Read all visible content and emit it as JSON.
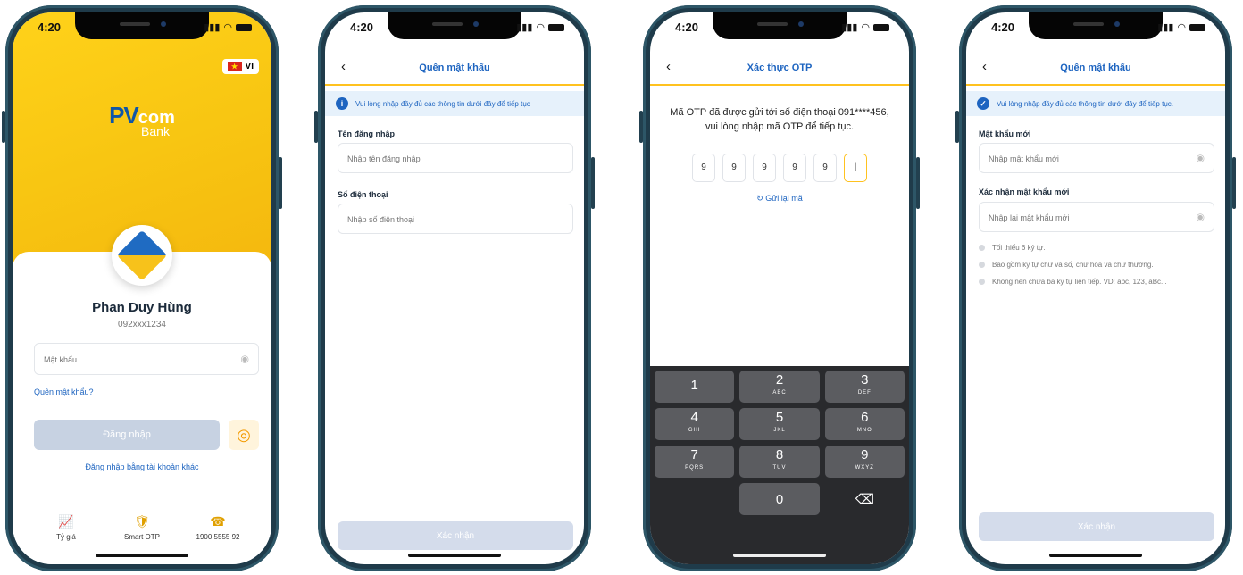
{
  "status": {
    "time": "4:20"
  },
  "screen1": {
    "lang": "VI",
    "flag_star": "★",
    "brand": {
      "pv": "PV",
      "com": "com",
      "bank": "Bank"
    },
    "user_name": "Phan Duy Hùng",
    "user_phone": "092xxx1234",
    "password_placeholder": "Mật khẩu",
    "forgot_link": "Quên mật khẩu?",
    "login_button": "Đăng nhập",
    "other_account_link": "Đăng nhập bằng tài khoản khác",
    "nav": [
      {
        "label": "Tỷ giá",
        "icon": "chart-icon"
      },
      {
        "label": "Smart OTP",
        "icon": "shield-icon"
      },
      {
        "label": "1900 5555 92",
        "icon": "phone-icon"
      }
    ],
    "accent": "#f8c612"
  },
  "screen2": {
    "title": "Quên mật khẩu",
    "info": "Vui lòng nhập đầy đủ các thông tin dưới đây để tiếp tục",
    "username_label": "Tên đăng nhập",
    "username_placeholder": "Nhập tên đăng nhập",
    "phone_label": "Số điện thoại",
    "phone_placeholder": "Nhập số điện thoại",
    "confirm_button": "Xác nhận"
  },
  "screen3": {
    "title": "Xác thực OTP",
    "message_line1": "Mã OTP đã được gửi tới số điện thoại 091****456,",
    "message_line2": "vui lòng nhập mã OTP để tiếp tục.",
    "otp_digits": [
      "9",
      "9",
      "9",
      "9",
      "9",
      "|"
    ],
    "resend": "Gửi lại mã",
    "keys": [
      {
        "num": "1",
        "letters": ""
      },
      {
        "num": "2",
        "letters": "ABC"
      },
      {
        "num": "3",
        "letters": "DEF"
      },
      {
        "num": "4",
        "letters": "GHI"
      },
      {
        "num": "5",
        "letters": "JKL"
      },
      {
        "num": "6",
        "letters": "MNO"
      },
      {
        "num": "7",
        "letters": "PQRS"
      },
      {
        "num": "8",
        "letters": "TUV"
      },
      {
        "num": "9",
        "letters": "WXYZ"
      },
      {
        "num": "0",
        "letters": ""
      }
    ]
  },
  "screen4": {
    "title": "Quên mật khẩu",
    "info": "Vui lòng nhập đầy đủ các thông tin dưới đây để tiếp tục.",
    "new_pass_label": "Mật khẩu mới",
    "new_pass_placeholder": "Nhập mật khẩu mới",
    "confirm_pass_label": "Xác nhận mật khẩu mới",
    "confirm_pass_placeholder": "Nhập lại mật khẩu mới",
    "rules": [
      "Tối thiểu 6 ký tự.",
      "Bao gồm ký tự chữ và số, chữ hoa và chữ thường.",
      "Không nên chứa ba ký tự liên tiếp. VD: abc, 123, aBc..."
    ],
    "confirm_button": "Xác nhận"
  }
}
